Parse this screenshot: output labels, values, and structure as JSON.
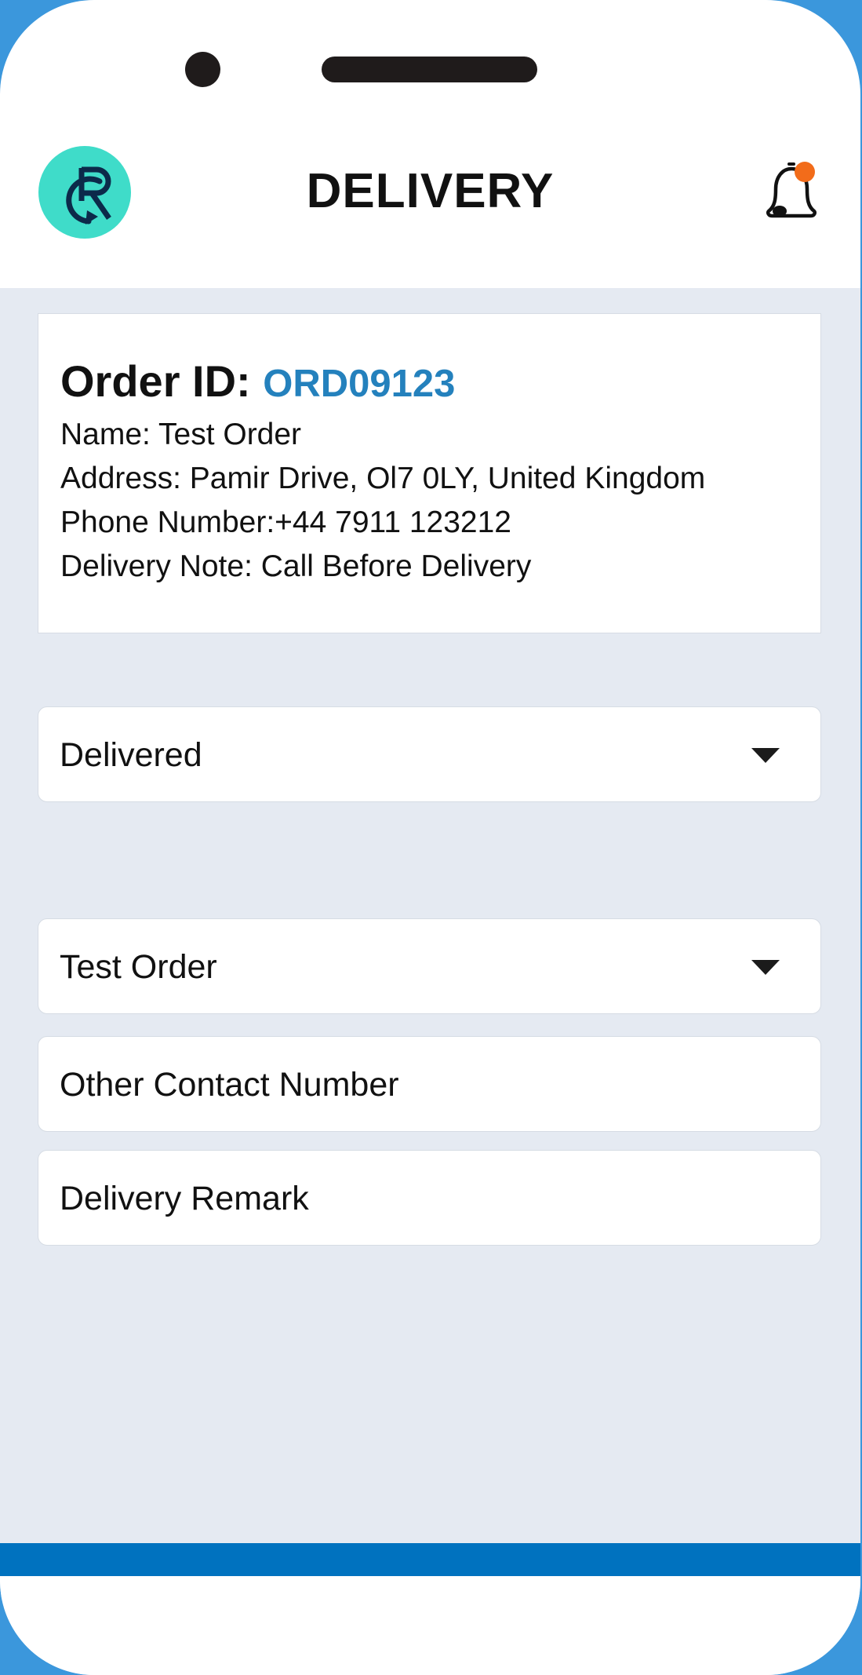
{
  "header": {
    "title": "DELIVERY"
  },
  "order": {
    "id_label": "Order ID:",
    "id_value": "ORD09123",
    "name": "Name: Test Order",
    "address": "Address: Pamir Drive, Ol7 0LY, United Kingdom",
    "phone": "Phone Number:+44 7911 123212",
    "note": "Delivery Note: Call Before Delivery"
  },
  "form": {
    "status_select": "Delivered",
    "order_select": "Test Order",
    "other_contact_placeholder": "Other Contact Number",
    "remark_placeholder": "Delivery Remark"
  },
  "colors": {
    "accent": "#2481bd",
    "logo_bg": "#3fdcc9",
    "notification_dot": "#f26c1a",
    "bottom_bar": "#0072bf",
    "background": "#e5eaf2"
  },
  "icons": {
    "logo": "app-logo",
    "notification": "bell-icon",
    "dropdown": "chevron-down-icon"
  }
}
